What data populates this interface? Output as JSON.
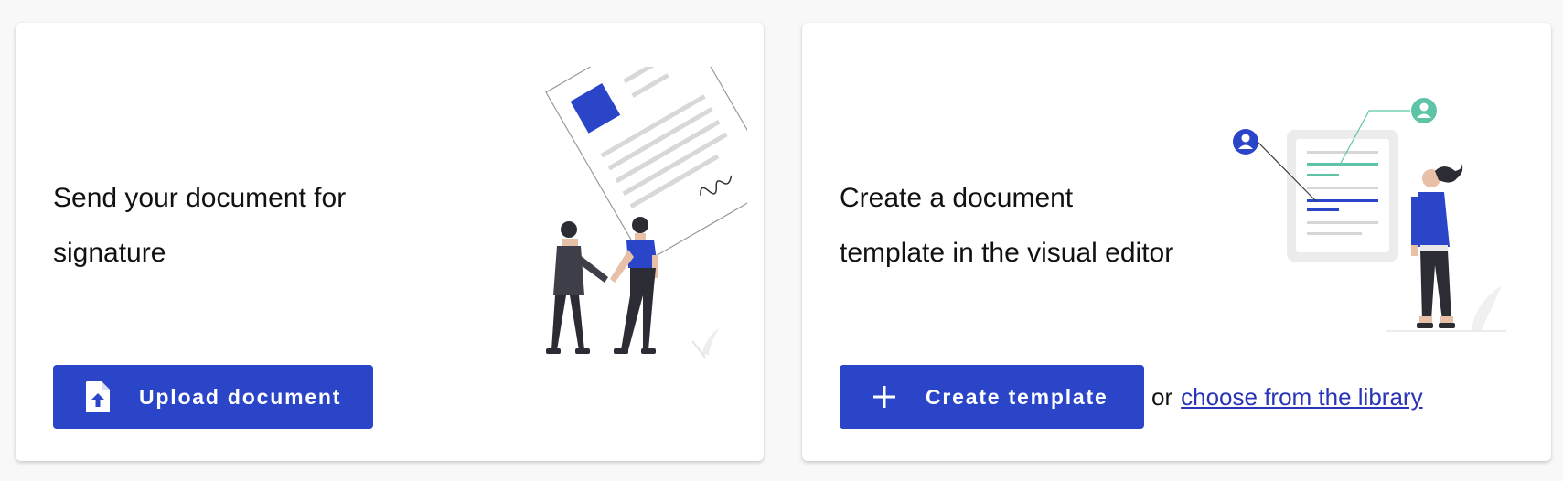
{
  "cards": [
    {
      "title_line1": "Send your document for",
      "title_line2": "signature",
      "button_label": "Upload document",
      "button_icon": "file-upload-icon",
      "illustration": "handshake-document-illustration"
    },
    {
      "title_line1": "Create a document",
      "title_line2": "template in the visual editor",
      "button_label": "Create template",
      "button_icon": "plus-icon",
      "or_text": "or",
      "library_link": "choose from the library",
      "illustration": "template-editor-illustration"
    }
  ],
  "colors": {
    "primary": "#2b45c9",
    "link": "#2a35b5",
    "accent_teal": "#5ec4a8",
    "background": "#f8f8f8",
    "card": "#ffffff"
  }
}
